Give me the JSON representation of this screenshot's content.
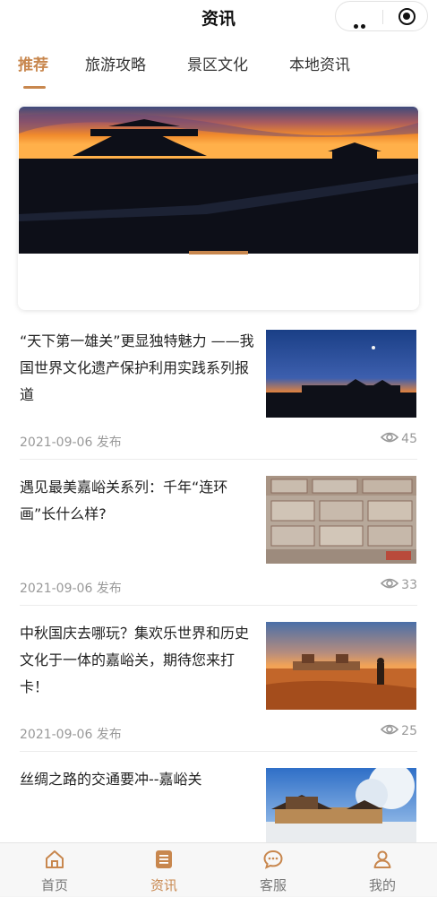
{
  "header": {
    "title": "资讯"
  },
  "tabs": [
    {
      "label": "推荐",
      "active": true
    },
    {
      "label": "旅游攻略",
      "active": false
    },
    {
      "label": "景区文化",
      "active": false
    },
    {
      "label": "本地资讯",
      "active": false
    }
  ],
  "articles": [
    {
      "title": "“天下第一雄关”更显独特魅力 ——我国世界文化遗产保护利用实践系列报道",
      "date": "2021-09-06 发布",
      "views": "45"
    },
    {
      "title": "遇见最美嘉峪关系列：千年“连环画”长什么样?",
      "date": "2021-09-06 发布",
      "views": "33"
    },
    {
      "title": "中秋国庆去哪玩？集欢乐世界和历史文化于一体的嘉峪关，期待您来打卡！",
      "date": "2021-09-06 发布",
      "views": "25"
    },
    {
      "title": "丝绸之路的交通要冲--嘉峪关"
    }
  ],
  "bottom_nav": [
    {
      "label": "首页",
      "icon": "home-icon",
      "active": false
    },
    {
      "label": "资讯",
      "icon": "news-icon",
      "active": true
    },
    {
      "label": "客服",
      "icon": "chat-icon",
      "active": false
    },
    {
      "label": "我的",
      "icon": "user-icon",
      "active": false
    }
  ],
  "colors": {
    "accent": "#c8874e",
    "muted": "#999999"
  }
}
